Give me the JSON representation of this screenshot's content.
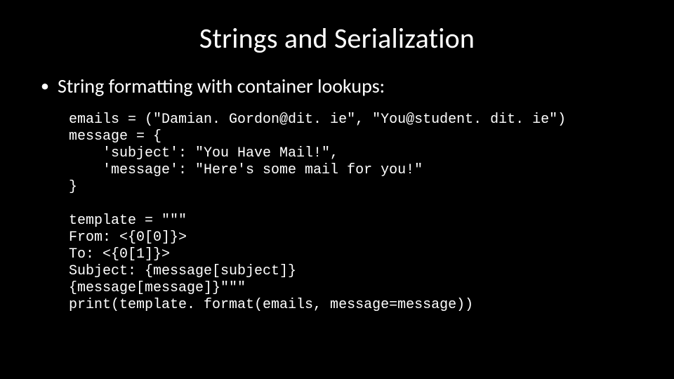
{
  "title": "Strings and Serialization",
  "bullet": "String formatting with container lookups:",
  "code1": "emails = (\"Damian. Gordon@dit. ie\", \"You@student. dit. ie\")\nmessage = {\n    'subject': \"You Have Mail!\",\n    'message': \"Here's some mail for you!\"\n}",
  "code2": "template = \"\"\"\nFrom: <{0[0]}>\nTo: <{0[1]}>\nSubject: {message[subject]}\n{message[message]}\"\"\"\nprint(template. format(emails, message=message))"
}
